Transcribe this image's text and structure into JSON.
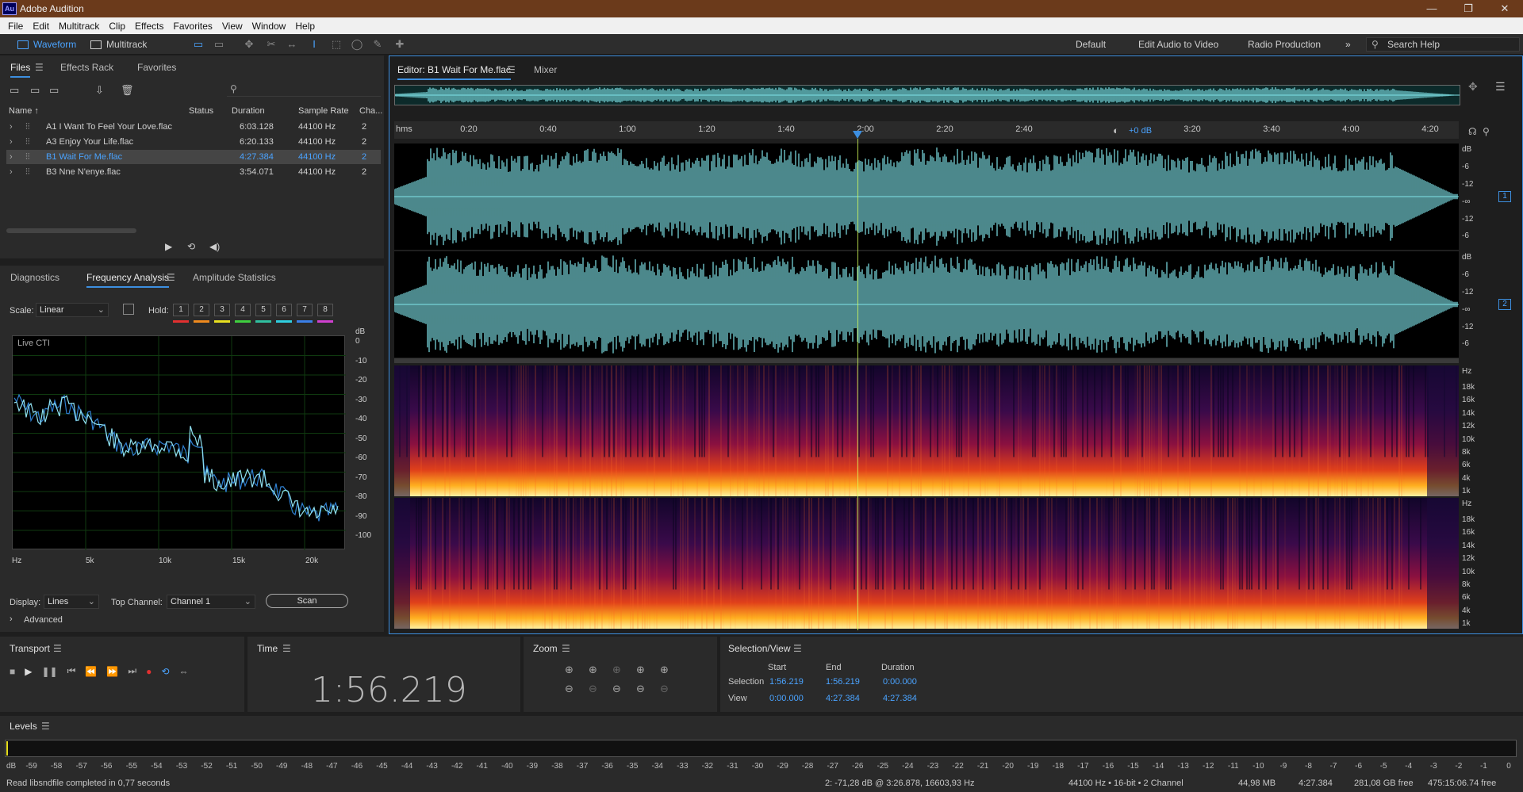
{
  "app": {
    "title": "Adobe Audition",
    "logo": "Au",
    "window_controls": [
      "—",
      "❐",
      "✕"
    ]
  },
  "menu": [
    "File",
    "Edit",
    "Multitrack",
    "Clip",
    "Effects",
    "Favorites",
    "View",
    "Window",
    "Help"
  ],
  "toolbar": {
    "waveform_label": "Waveform",
    "multitrack_label": "Multitrack",
    "workspaces": [
      "Default",
      "Edit Audio to Video",
      "Radio Production"
    ],
    "more": "»",
    "search_placeholder": "Search Help"
  },
  "files_panel": {
    "tabs": [
      "Files",
      "Effects Rack",
      "Favorites"
    ],
    "columns": [
      "Name ↑",
      "Status",
      "Duration",
      "Sample Rate",
      "Cha..."
    ],
    "rows": [
      {
        "name": "A1 I Want To Feel Your Love.flac",
        "duration": "6:03.128",
        "rate": "44100 Hz",
        "ch": "2",
        "selected": false
      },
      {
        "name": "A3 Enjoy Your Life.flac",
        "duration": "6:20.133",
        "rate": "44100 Hz",
        "ch": "2",
        "selected": false
      },
      {
        "name": "B1 Wait For Me.flac",
        "duration": "4:27.384",
        "rate": "44100 Hz",
        "ch": "2",
        "selected": true
      },
      {
        "name": "B3 Nne N'enye.flac",
        "duration": "3:54.071",
        "rate": "44100 Hz",
        "ch": "2",
        "selected": false
      }
    ]
  },
  "freq_panel": {
    "tabs": [
      "Diagnostics",
      "Frequency Analysis",
      "Amplitude Statistics"
    ],
    "scale_label": "Scale:",
    "scale_value": "Linear",
    "hold_label": "Hold:",
    "hold_buttons": [
      "1",
      "2",
      "3",
      "4",
      "5",
      "6",
      "7",
      "8"
    ],
    "hold_colors": [
      "#e23030",
      "#ef8a1e",
      "#e8e020",
      "#3fcf3f",
      "#30c0a0",
      "#2fcfe0",
      "#3a7fe8",
      "#d040d0"
    ],
    "plot_label": "Live CTI",
    "db_axis": [
      "dB",
      "0",
      "-10",
      "-20",
      "-30",
      "-40",
      "-50",
      "-60",
      "-70",
      "-80",
      "-90",
      "-100"
    ],
    "hz_axis": [
      "Hz",
      "5k",
      "10k",
      "15k",
      "20k"
    ],
    "display_label": "Display:",
    "display_value": "Lines",
    "top_channel_label": "Top Channel:",
    "top_channel_value": "Channel 1",
    "scan_label": "Scan",
    "advanced_label": "Advanced"
  },
  "editor": {
    "tab_label": "Editor: B1 Wait For Me.flac",
    "mixer_label": "Mixer",
    "ruler": [
      "hms",
      "0:20",
      "0:40",
      "1:00",
      "1:20",
      "1:40",
      "2:00",
      "2:20",
      "2:40",
      "3:20",
      "3:40",
      "4:00",
      "4:20"
    ],
    "hud_gain": "+0 dB",
    "db_scale": [
      "dB",
      "-6",
      "-12",
      "-∞",
      "-12",
      "-6"
    ],
    "hz_scale": [
      "Hz",
      "18k",
      "16k",
      "14k",
      "12k",
      "10k",
      "8k",
      "6k",
      "4k",
      "1k"
    ],
    "channels": [
      "1",
      "2"
    ]
  },
  "transport": {
    "title": "Transport"
  },
  "time": {
    "title": "Time",
    "value": "1:56.219"
  },
  "zoom": {
    "title": "Zoom"
  },
  "selection_view": {
    "title": "Selection/View",
    "col_start": "Start",
    "col_end": "End",
    "col_duration": "Duration",
    "row_selection": "Selection",
    "row_view": "View",
    "sel_start": "1:56.219",
    "sel_end": "1:56.219",
    "sel_duration": "0:00.000",
    "view_start": "0:00.000",
    "view_end": "4:27.384",
    "view_duration": "4:27.384"
  },
  "levels": {
    "title": "Levels",
    "scale": [
      "dB",
      "-59",
      "-58",
      "-57",
      "-56",
      "-55",
      "-54",
      "-53",
      "-52",
      "-51",
      "-50",
      "-49",
      "-48",
      "-47",
      "-46",
      "-45",
      "-44",
      "-43",
      "-42",
      "-41",
      "-40",
      "-39",
      "-38",
      "-37",
      "-36",
      "-35",
      "-34",
      "-33",
      "-32",
      "-31",
      "-30",
      "-29",
      "-28",
      "-27",
      "-26",
      "-25",
      "-24",
      "-23",
      "-22",
      "-21",
      "-20",
      "-19",
      "-18",
      "-17",
      "-16",
      "-15",
      "-14",
      "-13",
      "-12",
      "-11",
      "-10",
      "-9",
      "-8",
      "-7",
      "-6",
      "-5",
      "-4",
      "-3",
      "-2",
      "-1",
      "0"
    ]
  },
  "status": {
    "left": "Read libsndfile completed in 0,77 seconds",
    "cursor": "2: -71,28 dB @ 3:26.878, 16603,93 Hz",
    "format": "44100 Hz • 16-bit • 2 Channel",
    "size": "44,98 MB",
    "duration": "4:27.384",
    "free": "281,08 GB free",
    "free_time": "475:15:06.74 free"
  },
  "colors": {
    "accent": "#3d8fe0",
    "waveform": "#7fe3e8",
    "playhead": "#d7ff5a"
  }
}
